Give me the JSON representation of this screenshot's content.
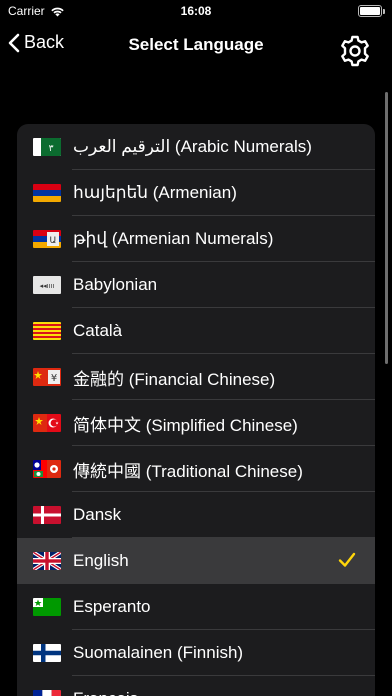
{
  "status": {
    "carrier": "Carrier",
    "time": "16:08"
  },
  "nav": {
    "back_label": "Back",
    "title": "Select Language"
  },
  "colors": {
    "accent": "#ffd60a",
    "row_bg": "#1c1c1e",
    "selected_bg": "#3a3a3c"
  },
  "languages": [
    {
      "label": "الترقيم العرب (Arabic Numerals)",
      "flag": "arabic-numerals-flag-icon",
      "selected": false
    },
    {
      "label": "հայերեն (Armenian)",
      "flag": "armenia-flag-icon",
      "selected": false
    },
    {
      "label": "թիվ (Armenian Numerals)",
      "flag": "armenian-numerals-flag-icon",
      "selected": false
    },
    {
      "label": "Babylonian",
      "flag": "babylonian-flag-icon",
      "selected": false
    },
    {
      "label": "Català",
      "flag": "catalonia-flag-icon",
      "selected": false
    },
    {
      "label": "金融的 (Financial Chinese)",
      "flag": "financial-chinese-flag-icon",
      "selected": false
    },
    {
      "label": "简体中文 (Simplified Chinese)",
      "flag": "simplified-chinese-flag-icon",
      "selected": false
    },
    {
      "label": "傳統中國 (Traditional Chinese)",
      "flag": "traditional-chinese-flag-icon",
      "selected": false
    },
    {
      "label": "Dansk",
      "flag": "denmark-flag-icon",
      "selected": false
    },
    {
      "label": "English",
      "flag": "uk-flag-icon",
      "selected": true
    },
    {
      "label": "Esperanto",
      "flag": "esperanto-flag-icon",
      "selected": false
    },
    {
      "label": "Suomalainen (Finnish)",
      "flag": "finland-flag-icon",
      "selected": false
    },
    {
      "label": "Français",
      "flag": "france-flag-icon",
      "selected": false
    }
  ]
}
